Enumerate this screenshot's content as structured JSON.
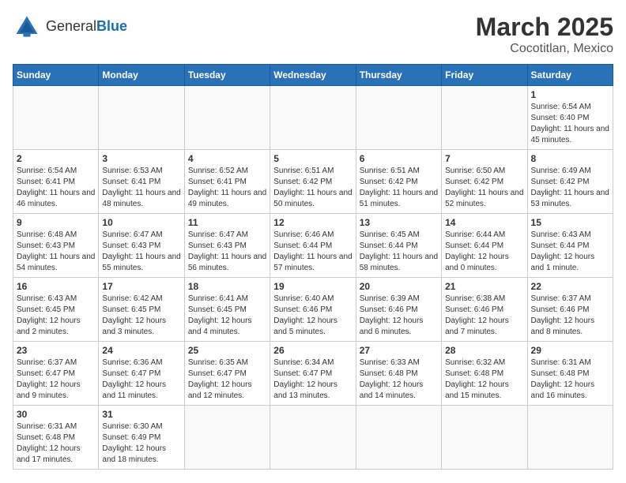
{
  "header": {
    "logo_general": "General",
    "logo_blue": "Blue",
    "title": "March 2025",
    "subtitle": "Cocotitlan, Mexico"
  },
  "days_of_week": [
    "Sunday",
    "Monday",
    "Tuesday",
    "Wednesday",
    "Thursday",
    "Friday",
    "Saturday"
  ],
  "weeks": [
    [
      {
        "day": "",
        "info": ""
      },
      {
        "day": "",
        "info": ""
      },
      {
        "day": "",
        "info": ""
      },
      {
        "day": "",
        "info": ""
      },
      {
        "day": "",
        "info": ""
      },
      {
        "day": "",
        "info": ""
      },
      {
        "day": "1",
        "info": "Sunrise: 6:54 AM\nSunset: 6:40 PM\nDaylight: 11 hours and 45 minutes."
      }
    ],
    [
      {
        "day": "2",
        "info": "Sunrise: 6:54 AM\nSunset: 6:41 PM\nDaylight: 11 hours and 46 minutes."
      },
      {
        "day": "3",
        "info": "Sunrise: 6:53 AM\nSunset: 6:41 PM\nDaylight: 11 hours and 48 minutes."
      },
      {
        "day": "4",
        "info": "Sunrise: 6:52 AM\nSunset: 6:41 PM\nDaylight: 11 hours and 49 minutes."
      },
      {
        "day": "5",
        "info": "Sunrise: 6:51 AM\nSunset: 6:42 PM\nDaylight: 11 hours and 50 minutes."
      },
      {
        "day": "6",
        "info": "Sunrise: 6:51 AM\nSunset: 6:42 PM\nDaylight: 11 hours and 51 minutes."
      },
      {
        "day": "7",
        "info": "Sunrise: 6:50 AM\nSunset: 6:42 PM\nDaylight: 11 hours and 52 minutes."
      },
      {
        "day": "8",
        "info": "Sunrise: 6:49 AM\nSunset: 6:42 PM\nDaylight: 11 hours and 53 minutes."
      }
    ],
    [
      {
        "day": "9",
        "info": "Sunrise: 6:48 AM\nSunset: 6:43 PM\nDaylight: 11 hours and 54 minutes."
      },
      {
        "day": "10",
        "info": "Sunrise: 6:47 AM\nSunset: 6:43 PM\nDaylight: 11 hours and 55 minutes."
      },
      {
        "day": "11",
        "info": "Sunrise: 6:47 AM\nSunset: 6:43 PM\nDaylight: 11 hours and 56 minutes."
      },
      {
        "day": "12",
        "info": "Sunrise: 6:46 AM\nSunset: 6:44 PM\nDaylight: 11 hours and 57 minutes."
      },
      {
        "day": "13",
        "info": "Sunrise: 6:45 AM\nSunset: 6:44 PM\nDaylight: 11 hours and 58 minutes."
      },
      {
        "day": "14",
        "info": "Sunrise: 6:44 AM\nSunset: 6:44 PM\nDaylight: 12 hours and 0 minutes."
      },
      {
        "day": "15",
        "info": "Sunrise: 6:43 AM\nSunset: 6:44 PM\nDaylight: 12 hours and 1 minute."
      }
    ],
    [
      {
        "day": "16",
        "info": "Sunrise: 6:43 AM\nSunset: 6:45 PM\nDaylight: 12 hours and 2 minutes."
      },
      {
        "day": "17",
        "info": "Sunrise: 6:42 AM\nSunset: 6:45 PM\nDaylight: 12 hours and 3 minutes."
      },
      {
        "day": "18",
        "info": "Sunrise: 6:41 AM\nSunset: 6:45 PM\nDaylight: 12 hours and 4 minutes."
      },
      {
        "day": "19",
        "info": "Sunrise: 6:40 AM\nSunset: 6:46 PM\nDaylight: 12 hours and 5 minutes."
      },
      {
        "day": "20",
        "info": "Sunrise: 6:39 AM\nSunset: 6:46 PM\nDaylight: 12 hours and 6 minutes."
      },
      {
        "day": "21",
        "info": "Sunrise: 6:38 AM\nSunset: 6:46 PM\nDaylight: 12 hours and 7 minutes."
      },
      {
        "day": "22",
        "info": "Sunrise: 6:37 AM\nSunset: 6:46 PM\nDaylight: 12 hours and 8 minutes."
      }
    ],
    [
      {
        "day": "23",
        "info": "Sunrise: 6:37 AM\nSunset: 6:47 PM\nDaylight: 12 hours and 9 minutes."
      },
      {
        "day": "24",
        "info": "Sunrise: 6:36 AM\nSunset: 6:47 PM\nDaylight: 12 hours and 11 minutes."
      },
      {
        "day": "25",
        "info": "Sunrise: 6:35 AM\nSunset: 6:47 PM\nDaylight: 12 hours and 12 minutes."
      },
      {
        "day": "26",
        "info": "Sunrise: 6:34 AM\nSunset: 6:47 PM\nDaylight: 12 hours and 13 minutes."
      },
      {
        "day": "27",
        "info": "Sunrise: 6:33 AM\nSunset: 6:48 PM\nDaylight: 12 hours and 14 minutes."
      },
      {
        "day": "28",
        "info": "Sunrise: 6:32 AM\nSunset: 6:48 PM\nDaylight: 12 hours and 15 minutes."
      },
      {
        "day": "29",
        "info": "Sunrise: 6:31 AM\nSunset: 6:48 PM\nDaylight: 12 hours and 16 minutes."
      }
    ],
    [
      {
        "day": "30",
        "info": "Sunrise: 6:31 AM\nSunset: 6:48 PM\nDaylight: 12 hours and 17 minutes."
      },
      {
        "day": "31",
        "info": "Sunrise: 6:30 AM\nSunset: 6:49 PM\nDaylight: 12 hours and 18 minutes."
      },
      {
        "day": "",
        "info": ""
      },
      {
        "day": "",
        "info": ""
      },
      {
        "day": "",
        "info": ""
      },
      {
        "day": "",
        "info": ""
      },
      {
        "day": "",
        "info": ""
      }
    ]
  ]
}
